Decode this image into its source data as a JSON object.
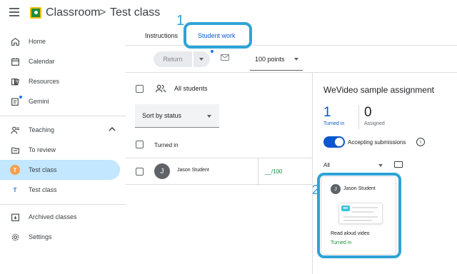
{
  "header": {
    "app_title": "Classroom",
    "separator": ">",
    "class_name": "Test class"
  },
  "sidebar": {
    "items": [
      {
        "label": "Home",
        "icon": "home-icon"
      },
      {
        "label": "Calendar",
        "icon": "calendar-icon"
      },
      {
        "label": "Resources",
        "icon": "resources-icon"
      },
      {
        "label": "Gemini",
        "icon": "gemini-icon"
      }
    ],
    "teaching_section": {
      "label": "Teaching",
      "icon": "teaching-icon"
    },
    "teaching_items": [
      {
        "label": "To review",
        "icon": "to-review-icon"
      },
      {
        "label": "Test class",
        "avatar": "T",
        "active": true
      },
      {
        "label": "Test class",
        "avatar": "T",
        "active": false
      }
    ],
    "bottom_items": [
      {
        "label": "Archived classes",
        "icon": "archive-icon"
      },
      {
        "label": "Settings",
        "icon": "settings-icon"
      }
    ]
  },
  "tabs": {
    "instructions": "Instructions",
    "student_work": "Student work"
  },
  "callouts": {
    "one": "1",
    "two": "2"
  },
  "toolbar": {
    "return_label": "Return",
    "points_value": "100 points"
  },
  "roster": {
    "all_students": "All students",
    "sort_label": "Sort by status",
    "group_header": "Turned in",
    "students": [
      {
        "avatar": "J",
        "name": "Jason Student",
        "grade": "__/100"
      }
    ]
  },
  "assignment": {
    "title": "WeVideo sample assignment",
    "turned_in_count": "1",
    "turned_in_label": "Turned in",
    "assigned_count": "0",
    "assigned_label": "Assigned",
    "accepting_label": "Accepting submissions",
    "accepting_on": true,
    "filter_label": "All"
  },
  "submission_card": {
    "avatar": "J",
    "student_name": "Jason Student",
    "thumb_logo": "we",
    "title": "Read aloud video",
    "status": "Turned in"
  },
  "colors": {
    "accent_blue": "#0b57d0",
    "active_nav": "#c2e7ff",
    "callout": "#2ea3d6",
    "status_green": "#1e8e3e"
  }
}
